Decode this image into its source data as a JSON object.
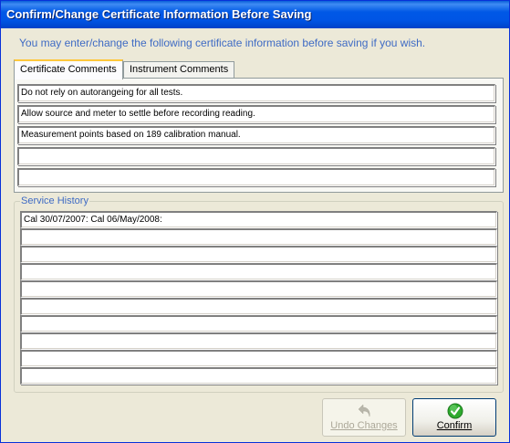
{
  "window": {
    "title": "Confirm/Change Certificate Information Before Saving"
  },
  "intro_text": "You may enter/change the following certificate information before saving if you wish.",
  "tabs": [
    {
      "label": "Certificate Comments",
      "active": true
    },
    {
      "label": "Instrument Comments",
      "active": false
    }
  ],
  "certificate_comments": [
    "Do not rely on autorangeing for all tests.",
    "Allow source and meter to settle before recording reading.",
    "Measurement points based on 189 calibration manual.",
    "",
    ""
  ],
  "service_history": {
    "label": "Service History",
    "lines": [
      "Cal 30/07/2007: Cal 06/May/2008:",
      "",
      "",
      "",
      "",
      "",
      "",
      "",
      "",
      ""
    ]
  },
  "buttons": {
    "undo": {
      "label": "Undo Changes",
      "enabled": false,
      "icon": "undo-arrow-icon"
    },
    "confirm": {
      "label": "Confirm",
      "enabled": true,
      "icon": "green-check-icon"
    }
  },
  "colors": {
    "title_bar": "#0055e5",
    "accent_text": "#3f6bc4",
    "confirm_icon": "#2eaa2e"
  }
}
